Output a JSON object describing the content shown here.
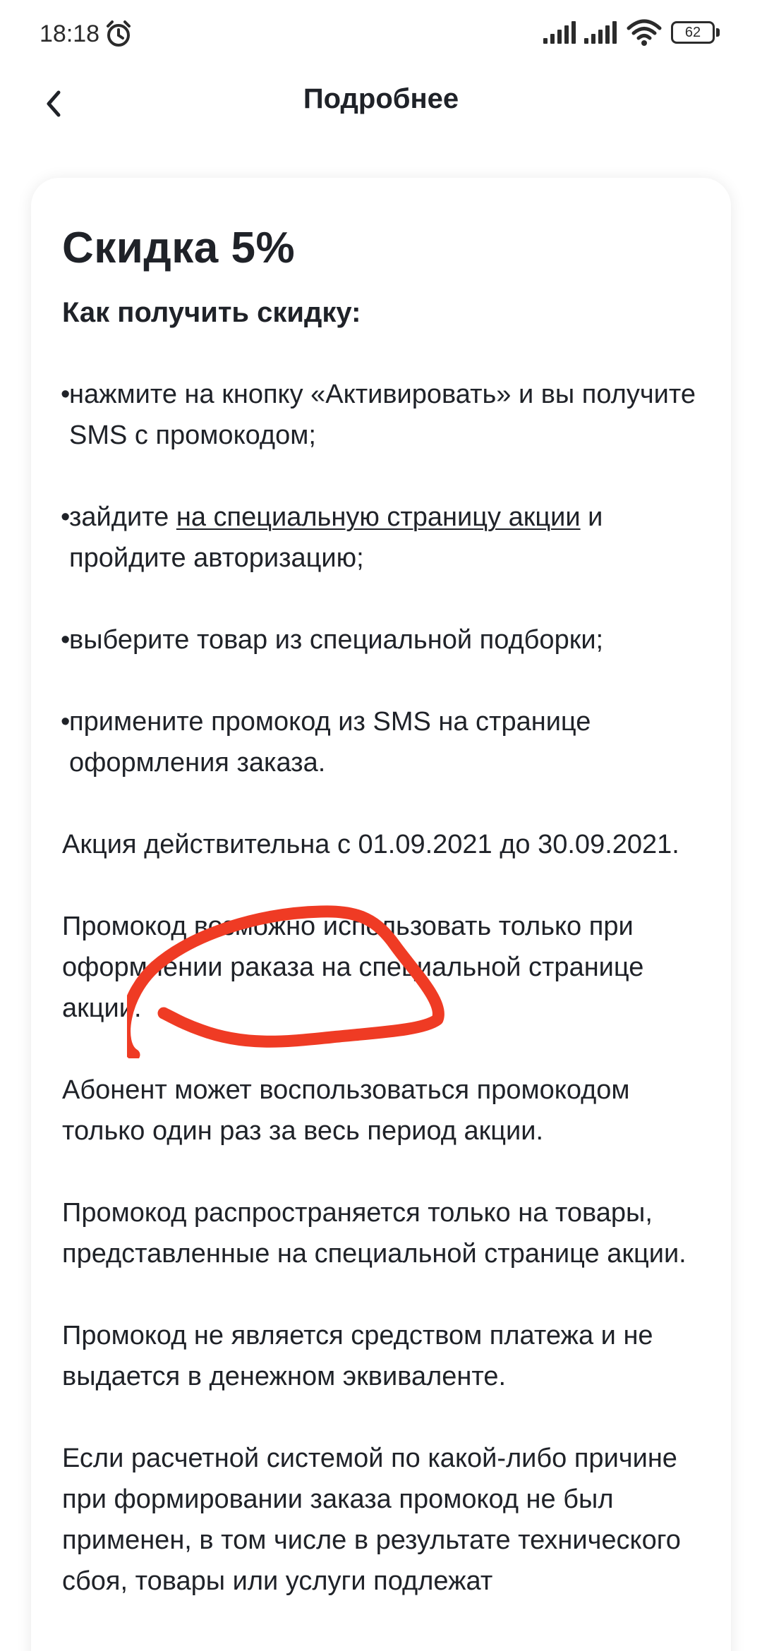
{
  "status_bar": {
    "time": "18:18",
    "battery": "62",
    "icons": [
      "alarm-icon",
      "signal-icon",
      "signal-icon",
      "wifi-icon",
      "battery-icon"
    ]
  },
  "header": {
    "back_icon": "chevron-left-icon",
    "title": "Подробнее"
  },
  "card": {
    "title": "Скидка 5%",
    "how_to_title": "Как получить скидку:",
    "bullet": "•",
    "steps": [
      {
        "text": "нажмите на кнопку «Активировать» и вы получите SMS с промокодом;"
      },
      {
        "before": "зайдите ",
        "link": "на специальную страницу акции",
        "after": " и пройдите авторизацию;"
      },
      {
        "text": "выберите товар из специальной подборки;"
      },
      {
        "text": "примените промокод из SMS на странице оформления заказа."
      }
    ],
    "paragraphs": [
      "Акция действительна с 01.09.2021 до 30.09.2021.",
      "Промокод возможно использовать только при оформлении раказа на специальной странице акции.",
      "Абонент может воспользоваться промокодом только один раз за весь период акции.",
      "Промокод распространяется только на товары, представленные на специальной странице акции.",
      "Промокод не является средством платежа и не выдается в денежном эквиваленте.",
      "Если расчетной системой по какой-либо причине при формировании заказа промокод не был применен, в том числе в результате технического сбоя, товары или услуги подлежат"
    ]
  },
  "colors": {
    "background": "#ffffff",
    "text": "#1f2228",
    "annotation": "#ef3b24"
  }
}
